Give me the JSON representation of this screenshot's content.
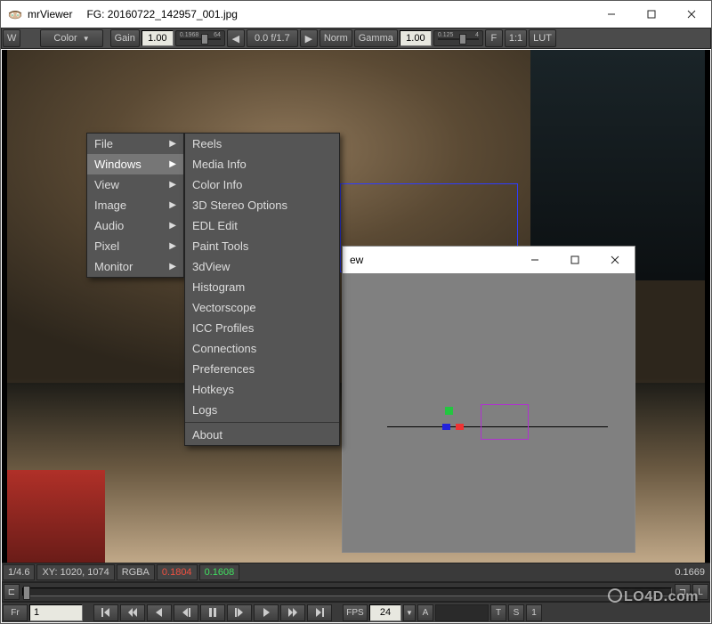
{
  "window": {
    "app_name": "mrViewer",
    "title_value": "FG: 20160722_142957_001.jpg"
  },
  "toolbar": {
    "w_label": "W",
    "color_label": "Color",
    "gain_label": "Gain",
    "gain_value": "1.00",
    "gain_slider_min": "0.1968",
    "gain_slider_max": "64",
    "fstop_back": "◀",
    "fstop_value": "0.0  f/1.7",
    "fstop_fwd": "▶",
    "norm_label": "Norm",
    "gamma_label": "Gamma",
    "gamma_value": "1.00",
    "gamma_slider_min": "0.125",
    "gamma_slider_max": "4",
    "f_label": "F",
    "one_one_label": "1:1",
    "lut_label": "LUT"
  },
  "context_menu": {
    "items": [
      "File",
      "Windows",
      "View",
      "Image",
      "Audio",
      "Pixel",
      "Monitor"
    ],
    "hovered_index": 1,
    "submenu": [
      "Reels",
      "Media Info",
      "Color Info",
      "3D Stereo Options",
      "EDL Edit",
      "Paint Tools",
      "3dView",
      "Histogram",
      "Vectorscope",
      "ICC Profiles",
      "Connections",
      "Preferences",
      "Hotkeys",
      "Logs",
      "About"
    ]
  },
  "subwindow": {
    "title_fragment": "ew"
  },
  "status": {
    "zoom": "1/4.6",
    "xy_label": "XY:",
    "xy_value": "1020, 1074",
    "channels": "RGBA",
    "r": "0.1804",
    "g": "0.1608",
    "last": "0.1669"
  },
  "timeline": {
    "l_label": "L"
  },
  "transport": {
    "frame_label": "Fr",
    "frame_value": "1",
    "fps_label": "FPS",
    "fps_value": "24",
    "a_label": "A",
    "t_label": "T",
    "s_label": "S",
    "one_label": "1"
  },
  "watermark": "LO4D.com"
}
